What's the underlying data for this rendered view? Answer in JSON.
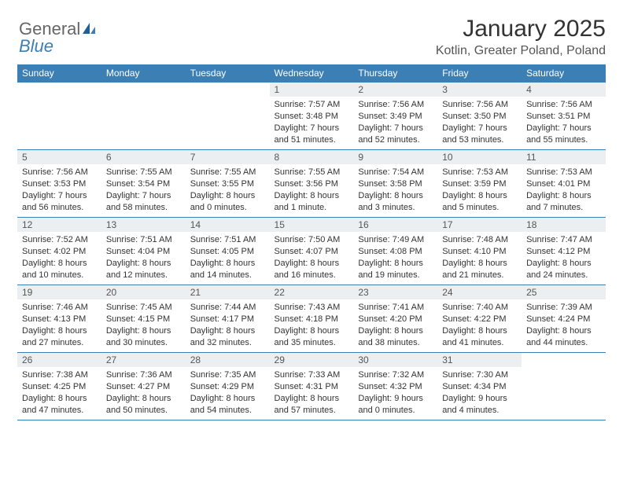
{
  "logo": {
    "word1": "General",
    "word2": "Blue"
  },
  "title": "January 2025",
  "location": "Kotlin, Greater Poland, Poland",
  "weekdays": [
    "Sunday",
    "Monday",
    "Tuesday",
    "Wednesday",
    "Thursday",
    "Friday",
    "Saturday"
  ],
  "weeks": [
    [
      null,
      null,
      null,
      {
        "n": "1",
        "sr": "Sunrise: 7:57 AM",
        "ss": "Sunset: 3:48 PM",
        "d1": "Daylight: 7 hours",
        "d2": "and 51 minutes."
      },
      {
        "n": "2",
        "sr": "Sunrise: 7:56 AM",
        "ss": "Sunset: 3:49 PM",
        "d1": "Daylight: 7 hours",
        "d2": "and 52 minutes."
      },
      {
        "n": "3",
        "sr": "Sunrise: 7:56 AM",
        "ss": "Sunset: 3:50 PM",
        "d1": "Daylight: 7 hours",
        "d2": "and 53 minutes."
      },
      {
        "n": "4",
        "sr": "Sunrise: 7:56 AM",
        "ss": "Sunset: 3:51 PM",
        "d1": "Daylight: 7 hours",
        "d2": "and 55 minutes."
      }
    ],
    [
      {
        "n": "5",
        "sr": "Sunrise: 7:56 AM",
        "ss": "Sunset: 3:53 PM",
        "d1": "Daylight: 7 hours",
        "d2": "and 56 minutes."
      },
      {
        "n": "6",
        "sr": "Sunrise: 7:55 AM",
        "ss": "Sunset: 3:54 PM",
        "d1": "Daylight: 7 hours",
        "d2": "and 58 minutes."
      },
      {
        "n": "7",
        "sr": "Sunrise: 7:55 AM",
        "ss": "Sunset: 3:55 PM",
        "d1": "Daylight: 8 hours",
        "d2": "and 0 minutes."
      },
      {
        "n": "8",
        "sr": "Sunrise: 7:55 AM",
        "ss": "Sunset: 3:56 PM",
        "d1": "Daylight: 8 hours",
        "d2": "and 1 minute."
      },
      {
        "n": "9",
        "sr": "Sunrise: 7:54 AM",
        "ss": "Sunset: 3:58 PM",
        "d1": "Daylight: 8 hours",
        "d2": "and 3 minutes."
      },
      {
        "n": "10",
        "sr": "Sunrise: 7:53 AM",
        "ss": "Sunset: 3:59 PM",
        "d1": "Daylight: 8 hours",
        "d2": "and 5 minutes."
      },
      {
        "n": "11",
        "sr": "Sunrise: 7:53 AM",
        "ss": "Sunset: 4:01 PM",
        "d1": "Daylight: 8 hours",
        "d2": "and 7 minutes."
      }
    ],
    [
      {
        "n": "12",
        "sr": "Sunrise: 7:52 AM",
        "ss": "Sunset: 4:02 PM",
        "d1": "Daylight: 8 hours",
        "d2": "and 10 minutes."
      },
      {
        "n": "13",
        "sr": "Sunrise: 7:51 AM",
        "ss": "Sunset: 4:04 PM",
        "d1": "Daylight: 8 hours",
        "d2": "and 12 minutes."
      },
      {
        "n": "14",
        "sr": "Sunrise: 7:51 AM",
        "ss": "Sunset: 4:05 PM",
        "d1": "Daylight: 8 hours",
        "d2": "and 14 minutes."
      },
      {
        "n": "15",
        "sr": "Sunrise: 7:50 AM",
        "ss": "Sunset: 4:07 PM",
        "d1": "Daylight: 8 hours",
        "d2": "and 16 minutes."
      },
      {
        "n": "16",
        "sr": "Sunrise: 7:49 AM",
        "ss": "Sunset: 4:08 PM",
        "d1": "Daylight: 8 hours",
        "d2": "and 19 minutes."
      },
      {
        "n": "17",
        "sr": "Sunrise: 7:48 AM",
        "ss": "Sunset: 4:10 PM",
        "d1": "Daylight: 8 hours",
        "d2": "and 21 minutes."
      },
      {
        "n": "18",
        "sr": "Sunrise: 7:47 AM",
        "ss": "Sunset: 4:12 PM",
        "d1": "Daylight: 8 hours",
        "d2": "and 24 minutes."
      }
    ],
    [
      {
        "n": "19",
        "sr": "Sunrise: 7:46 AM",
        "ss": "Sunset: 4:13 PM",
        "d1": "Daylight: 8 hours",
        "d2": "and 27 minutes."
      },
      {
        "n": "20",
        "sr": "Sunrise: 7:45 AM",
        "ss": "Sunset: 4:15 PM",
        "d1": "Daylight: 8 hours",
        "d2": "and 30 minutes."
      },
      {
        "n": "21",
        "sr": "Sunrise: 7:44 AM",
        "ss": "Sunset: 4:17 PM",
        "d1": "Daylight: 8 hours",
        "d2": "and 32 minutes."
      },
      {
        "n": "22",
        "sr": "Sunrise: 7:43 AM",
        "ss": "Sunset: 4:18 PM",
        "d1": "Daylight: 8 hours",
        "d2": "and 35 minutes."
      },
      {
        "n": "23",
        "sr": "Sunrise: 7:41 AM",
        "ss": "Sunset: 4:20 PM",
        "d1": "Daylight: 8 hours",
        "d2": "and 38 minutes."
      },
      {
        "n": "24",
        "sr": "Sunrise: 7:40 AM",
        "ss": "Sunset: 4:22 PM",
        "d1": "Daylight: 8 hours",
        "d2": "and 41 minutes."
      },
      {
        "n": "25",
        "sr": "Sunrise: 7:39 AM",
        "ss": "Sunset: 4:24 PM",
        "d1": "Daylight: 8 hours",
        "d2": "and 44 minutes."
      }
    ],
    [
      {
        "n": "26",
        "sr": "Sunrise: 7:38 AM",
        "ss": "Sunset: 4:25 PM",
        "d1": "Daylight: 8 hours",
        "d2": "and 47 minutes."
      },
      {
        "n": "27",
        "sr": "Sunrise: 7:36 AM",
        "ss": "Sunset: 4:27 PM",
        "d1": "Daylight: 8 hours",
        "d2": "and 50 minutes."
      },
      {
        "n": "28",
        "sr": "Sunrise: 7:35 AM",
        "ss": "Sunset: 4:29 PM",
        "d1": "Daylight: 8 hours",
        "d2": "and 54 minutes."
      },
      {
        "n": "29",
        "sr": "Sunrise: 7:33 AM",
        "ss": "Sunset: 4:31 PM",
        "d1": "Daylight: 8 hours",
        "d2": "and 57 minutes."
      },
      {
        "n": "30",
        "sr": "Sunrise: 7:32 AM",
        "ss": "Sunset: 4:32 PM",
        "d1": "Daylight: 9 hours",
        "d2": "and 0 minutes."
      },
      {
        "n": "31",
        "sr": "Sunrise: 7:30 AM",
        "ss": "Sunset: 4:34 PM",
        "d1": "Daylight: 9 hours",
        "d2": "and 4 minutes."
      },
      null
    ]
  ]
}
